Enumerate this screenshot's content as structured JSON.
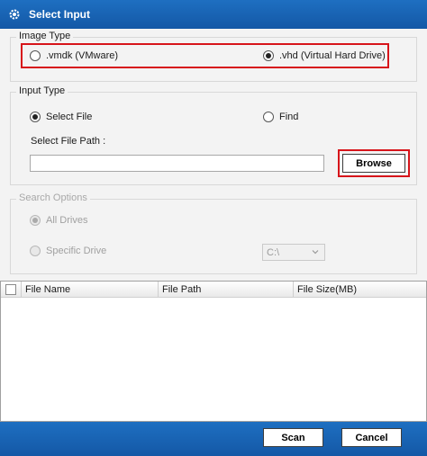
{
  "window": {
    "title": "Select Input",
    "icon": "app-gear-icon"
  },
  "image_type": {
    "legend": "Image Type",
    "options": [
      {
        "label": ".vmdk (VMware)",
        "checked": false
      },
      {
        "label": ".vhd (Virtual Hard Drive)",
        "checked": true
      }
    ]
  },
  "input_type": {
    "legend": "Input Type",
    "options": [
      {
        "label": "Select File",
        "checked": true
      },
      {
        "label": "Find",
        "checked": false
      }
    ],
    "path_label": "Select File Path :",
    "path_value": "",
    "browse_label": "Browse"
  },
  "search_options": {
    "legend": "Search Options",
    "options": [
      {
        "label": "All Drives",
        "checked": true
      },
      {
        "label": "Specific Drive",
        "checked": false
      }
    ],
    "drive_value": "C:\\"
  },
  "table": {
    "columns": [
      "File Name",
      "File Path",
      "File Size(MB)"
    ],
    "rows": []
  },
  "footer": {
    "scan_label": "Scan",
    "cancel_label": "Cancel"
  },
  "colors": {
    "title_bar": "#1565b8",
    "highlight": "#d7141a",
    "footer_bar": "#1565b8"
  }
}
